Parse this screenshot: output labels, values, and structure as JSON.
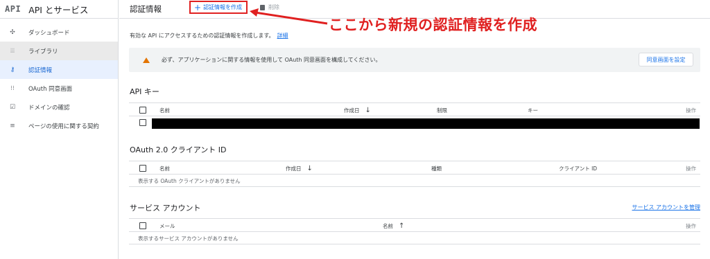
{
  "sidebar": {
    "logo": "API",
    "title": "API とサービス",
    "items": [
      {
        "label": "ダッシュボード",
        "icon": "dashboard-icon"
      },
      {
        "label": "ライブラリ",
        "icon": "library-icon"
      },
      {
        "label": "認証情報",
        "icon": "key-icon"
      },
      {
        "label": "OAuth 同意画面",
        "icon": "consent-icon"
      },
      {
        "label": "ドメインの確認",
        "icon": "checkbox-icon"
      },
      {
        "label": "ページの使用に関する契約",
        "icon": "settings-list-icon"
      }
    ]
  },
  "header": {
    "title": "認証情報",
    "create_label": "認証情報を作成",
    "delete_label": "削除"
  },
  "annotation": {
    "text": "ここから新規の認証情報を作成",
    "color": "#e02020"
  },
  "description": {
    "text": "有効な API にアクセスするための認証情報を作成します。",
    "link": "詳細"
  },
  "banner": {
    "text": "必ず、アプリケーションに関する情報を使用して OAuth 同意画面を構成してください。",
    "button": "同意画面を設定"
  },
  "api_keys": {
    "title": "API キー",
    "columns": [
      "名前",
      "作成日",
      "制限",
      "キー",
      "操作"
    ]
  },
  "oauth": {
    "title": "OAuth 2.0 クライアント ID",
    "columns": [
      "名前",
      "作成日",
      "種類",
      "クライアント ID",
      "操作"
    ],
    "empty": "表示する OAuth クライアントがありません"
  },
  "service_accounts": {
    "title": "サービス アカウント",
    "manage_link": "サービス アカウントを管理",
    "columns": [
      "メール",
      "名前",
      "操作"
    ],
    "empty": "表示するサービス アカウントがありません"
  },
  "colors": {
    "accent": "#1a73e8",
    "active_bg": "#e8f0fe",
    "warning": "#e37400"
  }
}
